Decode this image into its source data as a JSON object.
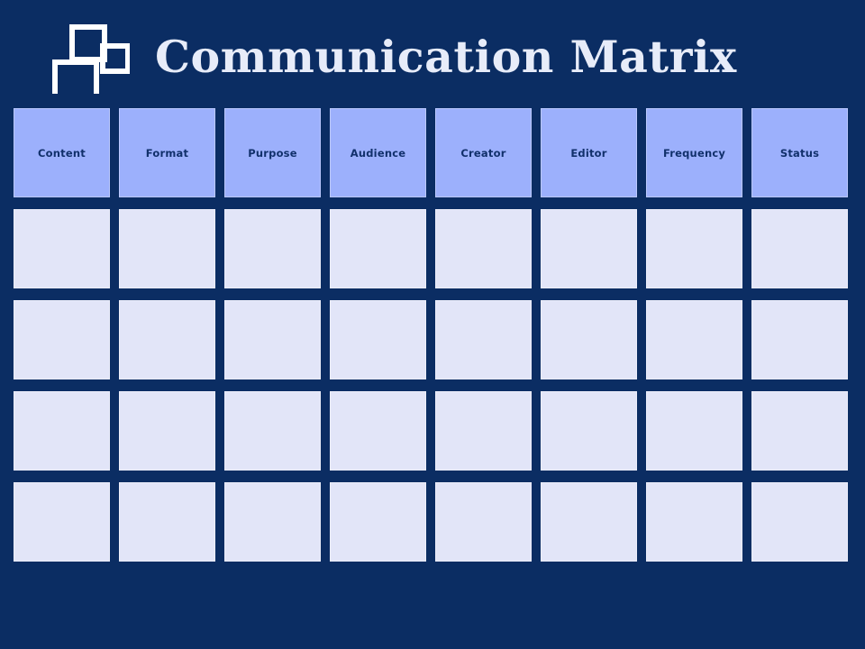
{
  "slide": {
    "background_color": "#0b2d63"
  },
  "header": {
    "title": "Communication Matrix",
    "title_color": "#e7ecf9",
    "logo": {
      "icon": "three-squares-outline-icon",
      "stroke_color": "#ffffff",
      "fill_color": "#0b2d63"
    }
  },
  "matrix": {
    "header_cell_color": "#9cb0fc",
    "header_text_color": "#11306b",
    "body_cell_color": "#e2e5f8",
    "columns": [
      {
        "label": "Content"
      },
      {
        "label": "Format"
      },
      {
        "label": "Purpose"
      },
      {
        "label": "Audience"
      },
      {
        "label": "Creator"
      },
      {
        "label": "Editor"
      },
      {
        "label": "Frequency"
      },
      {
        "label": "Status"
      }
    ],
    "rows": [
      {
        "cells": [
          "",
          "",
          "",
          "",
          "",
          "",
          "",
          ""
        ]
      },
      {
        "cells": [
          "",
          "",
          "",
          "",
          "",
          "",
          "",
          ""
        ]
      },
      {
        "cells": [
          "",
          "",
          "",
          "",
          "",
          "",
          "",
          ""
        ]
      },
      {
        "cells": [
          "",
          "",
          "",
          "",
          "",
          "",
          "",
          ""
        ]
      }
    ]
  }
}
